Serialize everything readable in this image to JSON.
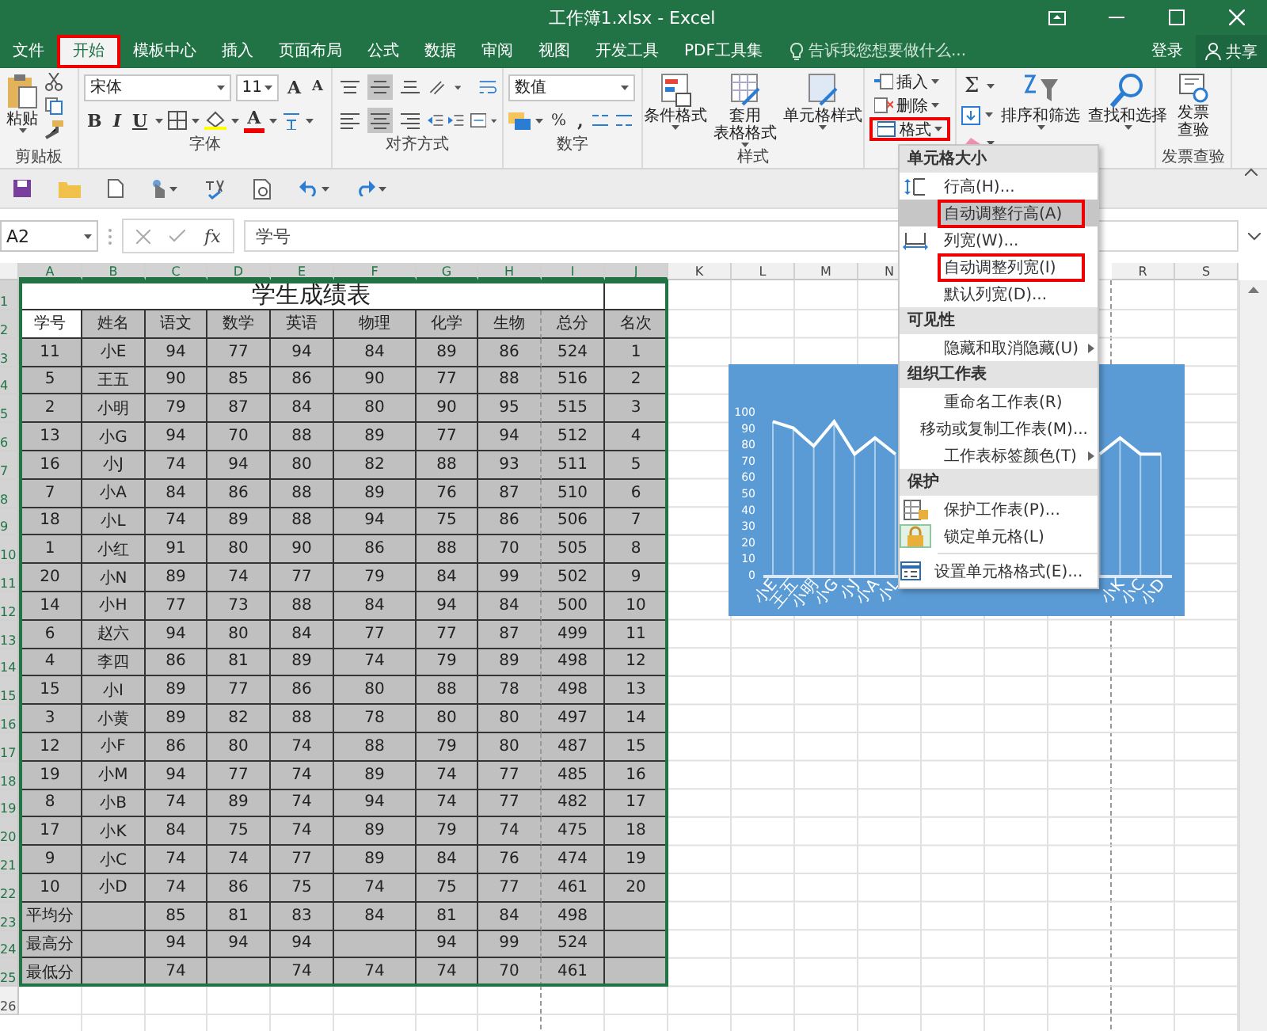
{
  "window": {
    "title": "工作簿1.xlsx - Excel"
  },
  "ribbon_tabs": [
    {
      "label": "文件",
      "selected": false,
      "marked": false
    },
    {
      "label": "开始",
      "selected": true,
      "marked": true
    },
    {
      "label": "模板中心",
      "selected": false,
      "marked": false
    },
    {
      "label": "插入",
      "selected": false,
      "marked": false
    },
    {
      "label": "页面布局",
      "selected": false,
      "marked": false
    },
    {
      "label": "公式",
      "selected": false,
      "marked": false
    },
    {
      "label": "数据",
      "selected": false,
      "marked": false
    },
    {
      "label": "审阅",
      "selected": false,
      "marked": false
    },
    {
      "label": "视图",
      "selected": false,
      "marked": false
    },
    {
      "label": "开发工具",
      "selected": false,
      "marked": false
    },
    {
      "label": "PDF工具集",
      "selected": false,
      "marked": false
    }
  ],
  "tell_me": {
    "placeholder": "告诉我您想要做什么..."
  },
  "account": {
    "sign_in": "登录",
    "share": "共享"
  },
  "ribbon": {
    "clipboard": {
      "label": "剪贴板",
      "paste": "粘贴"
    },
    "font": {
      "label": "字体",
      "name": "宋体",
      "size": "11",
      "grow": "A",
      "shrink": "A",
      "bold": "B",
      "italic": "I",
      "underline": "U",
      "font_color_glyph": "A"
    },
    "alignment": {
      "label": "对齐方式",
      "vertical": [
        {
          "selected": false
        },
        {
          "selected": true
        },
        {
          "selected": false
        }
      ],
      "horizontal": [
        {
          "selected": false
        },
        {
          "selected": true
        },
        {
          "selected": false
        }
      ]
    },
    "number": {
      "label": "数字",
      "format": "数值",
      "percent": "%",
      "comma": ","
    },
    "styles": {
      "label": "样式",
      "buttons": [
        {
          "lines": [
            "条件格式"
          ]
        },
        {
          "lines": [
            "套用",
            "表格格式"
          ]
        },
        {
          "lines": [
            "单元格样式"
          ]
        }
      ]
    },
    "cells": {
      "buttons": [
        {
          "label": "插入",
          "marked": false
        },
        {
          "label": "删除",
          "marked": false
        },
        {
          "label": "格式",
          "marked": true
        }
      ]
    },
    "editing": {
      "autosum": "Σ",
      "buttons": [
        {
          "label": "排序和筛选"
        },
        {
          "label": "查找和选择"
        }
      ]
    },
    "invoice": {
      "label": "发票查验",
      "lines": [
        "发票",
        "查验"
      ]
    }
  },
  "formula_bar": {
    "name_box": "A2",
    "insert_function": "fx",
    "value": "学号"
  },
  "sheet": {
    "columns": [
      {
        "label": "A",
        "selected": true
      },
      {
        "label": "B",
        "selected": true
      },
      {
        "label": "C",
        "selected": true
      },
      {
        "label": "D",
        "selected": true
      },
      {
        "label": "E",
        "selected": true
      },
      {
        "label": "F",
        "selected": true
      },
      {
        "label": "G",
        "selected": true
      },
      {
        "label": "H",
        "selected": true
      },
      {
        "label": "I",
        "selected": true
      },
      {
        "label": "J",
        "selected": true
      },
      {
        "label": "K",
        "selected": false
      },
      {
        "label": "L",
        "selected": false
      },
      {
        "label": "M",
        "selected": false
      },
      {
        "label": "N",
        "selected": false
      },
      null,
      null,
      null,
      {
        "label": "R",
        "selected": false
      },
      {
        "label": "S",
        "selected": false
      }
    ],
    "row_numbers": [
      {
        "label": "1",
        "selected": true
      },
      {
        "label": "2",
        "selected": true
      },
      {
        "label": "3",
        "selected": true
      },
      {
        "label": "4",
        "selected": true
      },
      {
        "label": "5",
        "selected": true
      },
      {
        "label": "6",
        "selected": true
      },
      {
        "label": "7",
        "selected": true
      },
      {
        "label": "8",
        "selected": true
      },
      {
        "label": "9",
        "selected": true
      },
      {
        "label": "10",
        "selected": true
      },
      {
        "label": "11",
        "selected": true
      },
      {
        "label": "12",
        "selected": true
      },
      {
        "label": "13",
        "selected": true
      },
      {
        "label": "14",
        "selected": true
      },
      {
        "label": "15",
        "selected": true
      },
      {
        "label": "16",
        "selected": true
      },
      {
        "label": "17",
        "selected": true
      },
      {
        "label": "18",
        "selected": true
      },
      {
        "label": "19",
        "selected": true
      },
      {
        "label": "20",
        "selected": true
      },
      {
        "label": "21",
        "selected": true
      },
      {
        "label": "22",
        "selected": true
      },
      {
        "label": "23",
        "selected": true
      },
      {
        "label": "24",
        "selected": true
      },
      {
        "label": "25",
        "selected": true
      },
      {
        "label": "26",
        "selected": false
      }
    ],
    "title": "学生成绩表",
    "header": [
      {
        "text": "学号",
        "selected": true
      },
      {
        "text": "姓名",
        "selected": false
      },
      {
        "text": "语文",
        "selected": false
      },
      {
        "text": "数学",
        "selected": false
      },
      {
        "text": "英语",
        "selected": false
      },
      {
        "text": "物理",
        "selected": false
      },
      {
        "text": "化学",
        "selected": false
      },
      {
        "text": "生物",
        "selected": false
      },
      {
        "text": "总分",
        "selected": false
      },
      {
        "text": "名次",
        "selected": false
      }
    ],
    "rows": [
      [
        "11",
        "小E",
        "94",
        "77",
        "94",
        "84",
        "89",
        "86",
        "524",
        "1"
      ],
      [
        "5",
        "王五",
        "90",
        "85",
        "86",
        "90",
        "77",
        "88",
        "516",
        "2"
      ],
      [
        "2",
        "小明",
        "79",
        "87",
        "84",
        "80",
        "90",
        "95",
        "515",
        "3"
      ],
      [
        "13",
        "小G",
        "94",
        "70",
        "88",
        "89",
        "77",
        "94",
        "512",
        "4"
      ],
      [
        "16",
        "小J",
        "74",
        "94",
        "80",
        "82",
        "88",
        "93",
        "511",
        "5"
      ],
      [
        "7",
        "小A",
        "84",
        "86",
        "88",
        "89",
        "76",
        "87",
        "510",
        "6"
      ],
      [
        "18",
        "小L",
        "74",
        "89",
        "88",
        "94",
        "75",
        "86",
        "506",
        "7"
      ],
      [
        "1",
        "小红",
        "91",
        "80",
        "90",
        "86",
        "88",
        "70",
        "505",
        "8"
      ],
      [
        "20",
        "小N",
        "89",
        "74",
        "77",
        "79",
        "84",
        "99",
        "502",
        "9"
      ],
      [
        "14",
        "小H",
        "77",
        "73",
        "88",
        "84",
        "94",
        "84",
        "500",
        "10"
      ],
      [
        "6",
        "赵六",
        "94",
        "80",
        "84",
        "77",
        "77",
        "87",
        "499",
        "11"
      ],
      [
        "4",
        "李四",
        "86",
        "81",
        "89",
        "74",
        "79",
        "89",
        "498",
        "12"
      ],
      [
        "15",
        "小I",
        "89",
        "77",
        "86",
        "80",
        "88",
        "78",
        "498",
        "13"
      ],
      [
        "3",
        "小黄",
        "89",
        "82",
        "88",
        "78",
        "80",
        "80",
        "497",
        "14"
      ],
      [
        "12",
        "小F",
        "86",
        "80",
        "74",
        "88",
        "79",
        "80",
        "487",
        "15"
      ],
      [
        "19",
        "小M",
        "94",
        "77",
        "74",
        "89",
        "74",
        "77",
        "485",
        "16"
      ],
      [
        "8",
        "小B",
        "74",
        "89",
        "74",
        "94",
        "74",
        "77",
        "482",
        "17"
      ],
      [
        "17",
        "小K",
        "84",
        "75",
        "74",
        "89",
        "79",
        "74",
        "475",
        "18"
      ],
      [
        "9",
        "小C",
        "74",
        "74",
        "77",
        "89",
        "84",
        "76",
        "474",
        "19"
      ],
      [
        "10",
        "小D",
        "74",
        "86",
        "75",
        "74",
        "75",
        "77",
        "461",
        "20"
      ],
      [
        "平均分",
        null,
        "85",
        "81",
        "83",
        "84",
        "81",
        "84",
        "498",
        null
      ],
      [
        "最高分",
        null,
        "94",
        "94",
        "94",
        null,
        "94",
        "99",
        "524",
        null
      ],
      [
        "最低分",
        null,
        "74",
        null,
        "74",
        "74",
        "74",
        "70",
        "461",
        null
      ]
    ]
  },
  "chart": {
    "chart_data": {
      "type": "line",
      "categories": [
        "小E",
        "王五",
        "小明",
        "小G",
        "小J",
        "小A",
        "小L",
        null,
        null,
        null,
        null,
        null,
        null,
        null,
        null,
        null,
        null,
        "小K",
        "小C",
        "小D"
      ],
      "series": [
        {
          "color": "#ffffff",
          "values": [
            94,
            90,
            79,
            94,
            74,
            84,
            74,
            null,
            null,
            null,
            null,
            null,
            null,
            null,
            null,
            null,
            74,
            84,
            74,
            74
          ]
        }
      ],
      "ylim": [
        0,
        100
      ],
      "yticks": [
        0,
        10,
        20,
        30,
        40,
        50,
        60,
        70,
        80,
        90,
        100
      ],
      "grid": true
    }
  },
  "format_menu": [
    {
      "kind": "header",
      "label": "单元格大小"
    },
    {
      "kind": "item",
      "label": "行高(H)...",
      "selected": false,
      "marked": false,
      "submenu": false,
      "checked": false
    },
    {
      "kind": "item",
      "label": "自动调整行高(A)",
      "selected": true,
      "marked": true,
      "submenu": false,
      "checked": false
    },
    {
      "kind": "item",
      "label": "列宽(W)...",
      "selected": false,
      "marked": false,
      "submenu": false,
      "checked": false
    },
    {
      "kind": "item",
      "label": "自动调整列宽(I)",
      "selected": false,
      "marked": true,
      "submenu": false,
      "checked": false
    },
    {
      "kind": "item",
      "label": "默认列宽(D)...",
      "selected": false,
      "marked": false,
      "submenu": false,
      "checked": false
    },
    {
      "kind": "header",
      "label": "可见性"
    },
    {
      "kind": "item",
      "label": "隐藏和取消隐藏(U)",
      "selected": false,
      "marked": false,
      "submenu": true,
      "checked": false
    },
    {
      "kind": "header",
      "label": "组织工作表"
    },
    {
      "kind": "item",
      "label": "重命名工作表(R)",
      "selected": false,
      "marked": false,
      "submenu": false,
      "checked": false
    },
    {
      "kind": "item",
      "label": "移动或复制工作表(M)...",
      "selected": false,
      "marked": false,
      "submenu": false,
      "checked": false
    },
    {
      "kind": "item",
      "label": "工作表标签颜色(T)",
      "selected": false,
      "marked": false,
      "submenu": true,
      "checked": false
    },
    {
      "kind": "header",
      "label": "保护"
    },
    {
      "kind": "item",
      "label": "保护工作表(P)...",
      "selected": false,
      "marked": false,
      "submenu": false,
      "checked": false
    },
    {
      "kind": "item",
      "label": "锁定单元格(L)",
      "selected": false,
      "marked": false,
      "submenu": false,
      "checked": true
    },
    {
      "kind": "separator"
    },
    {
      "kind": "item",
      "label": "设置单元格格式(E)...",
      "selected": false,
      "marked": false,
      "submenu": false,
      "checked": false
    }
  ]
}
